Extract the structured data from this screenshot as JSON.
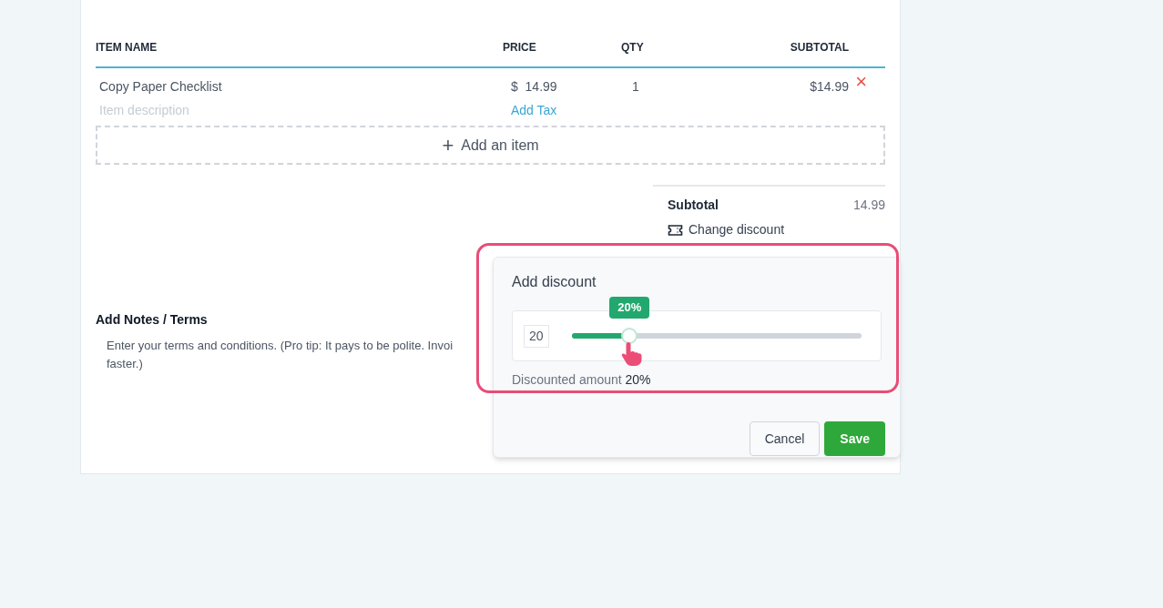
{
  "table": {
    "columns": [
      "ITEM NAME",
      "PRICE",
      "QTY",
      "SUBTOTAL"
    ],
    "rows": [
      {
        "name": "Copy Paper Checklist",
        "description_placeholder": "Item description",
        "price_currency": "$",
        "price": "14.99",
        "add_tax": "Add Tax",
        "qty": "1",
        "subtotal": "$14.99",
        "remove": "×"
      }
    ]
  },
  "add_item": {
    "icon": "+",
    "label": "Add an item"
  },
  "summary": {
    "subtotal_label": "Subtotal",
    "subtotal_value": "14.99",
    "change_discount": "Change discount"
  },
  "notes": {
    "title": "Add Notes / Terms",
    "lines": [
      "Enter your terms and conditions. (Pro tip: It pays to be polite. Invoi",
      "faster.)"
    ]
  },
  "discount_popover": {
    "title": "Add discount",
    "value": "20",
    "tooltip": "20%",
    "level": 0.2,
    "result_label": "Discounted amount",
    "result_value": "20%",
    "highlighted": true,
    "buttons": [
      {
        "label": "Cancel",
        "kind": "secondary"
      },
      {
        "label": "Save",
        "kind": "primary"
      }
    ]
  }
}
